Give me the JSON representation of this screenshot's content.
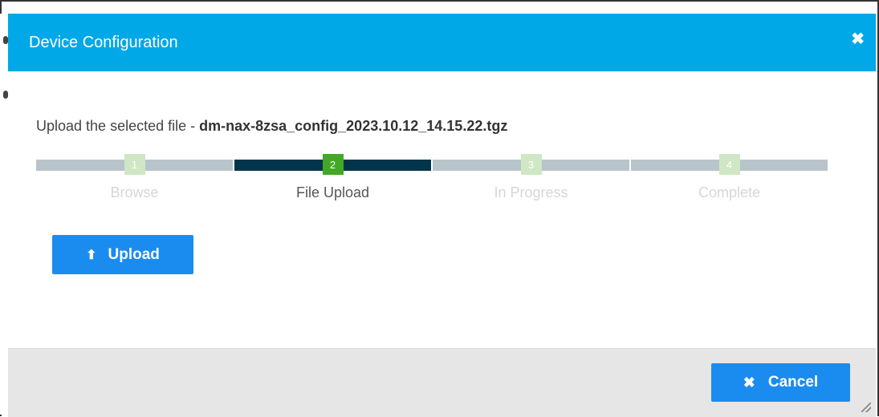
{
  "dialog": {
    "title": "Device Configuration",
    "close_icon": "close-icon"
  },
  "instruction": {
    "prefix": "Upload the selected file - ",
    "filename": "dm-nax-8zsa_config_2023.10.12_14.15.22.tgz"
  },
  "wizard": {
    "steps": [
      {
        "number": "1",
        "label": "Browse",
        "state": "inactive"
      },
      {
        "number": "2",
        "label": "File Upload",
        "state": "active"
      },
      {
        "number": "3",
        "label": "In Progress",
        "state": "inactive"
      },
      {
        "number": "4",
        "label": "Complete",
        "state": "inactive"
      }
    ]
  },
  "actions": {
    "upload_label": "Upload",
    "upload_icon": "upload-icon",
    "cancel_label": "Cancel",
    "cancel_icon": "close-icon"
  },
  "colors": {
    "header": "#00a8e8",
    "button": "#1a8cf0",
    "active_bar": "#00354a",
    "active_step": "#43a825",
    "inactive_step": "#cfe7c4",
    "inactive_bar": "#b8c4ca"
  }
}
